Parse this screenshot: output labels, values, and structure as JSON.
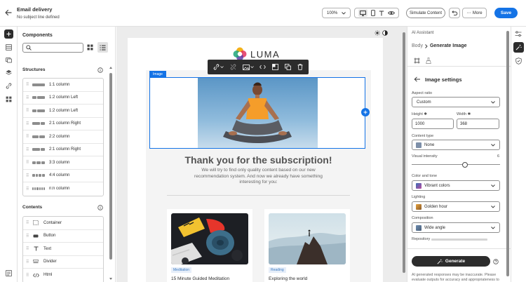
{
  "header": {
    "title": "Email delivery",
    "subtitle": "No subject line defined",
    "zoom": "100%",
    "simulate_label": "Simulate Content",
    "more_label": "More",
    "save_label": "Save"
  },
  "components": {
    "title": "Components",
    "search_placeholder": "",
    "structures_title": "Structures",
    "structures": [
      "1:1 column",
      "1:2 column Left",
      "1:2 column Left",
      "2:1 column Right",
      "2:2 column",
      "2:1 column Right",
      "3:3 column",
      "4:4 column",
      "n:n column"
    ],
    "contents_title": "Contents",
    "contents": [
      "Container",
      "Button",
      "Text",
      "Divider",
      "Html"
    ]
  },
  "canvas": {
    "brand": "LUMA",
    "image_badge": "Image",
    "headline": "Thank you for the subscription!",
    "body_text": "We will try to find only quality content based on our new recommendation system. And now we already have something interesting for you:",
    "cards": [
      {
        "tag": "Meditation",
        "title": "15 Minute Guided Meditation"
      },
      {
        "tag": "Reading",
        "title": "Exploring the world"
      }
    ]
  },
  "assistant": {
    "panel_title": "AI Assistant",
    "breadcrumb_root": "Body",
    "breadcrumb_current": "Generate Image",
    "section_title": "Image settings",
    "aspect_ratio_label": "Aspect ratio",
    "aspect_ratio_value": "Custom",
    "height_label": "Height",
    "height_value": "1000",
    "width_label": "Width",
    "width_value": "368",
    "content_type_label": "Content type",
    "content_type_value": "None",
    "visual_intensity_label": "Visual intensity",
    "visual_intensity_value": "6",
    "visual_intensity_max": 10,
    "color_tone_label": "Color and tone",
    "color_tone_value": "Vibrant colors",
    "lighting_label": "Lighting",
    "lighting_value": "Golden hour",
    "composition_label": "Composition",
    "composition_value": "Wide angle",
    "repository_label": "Repository",
    "generate_label": "Generate",
    "disclaimer": "AI generated responses may be inaccurate. Please evaluate outputs for accuracy and appropriateness to"
  },
  "colors": {
    "accent": "#1473e6",
    "toolbar": "#2c2c2c",
    "tag_text": "#3d7bc2",
    "tag_bg": "#e6eef9"
  }
}
